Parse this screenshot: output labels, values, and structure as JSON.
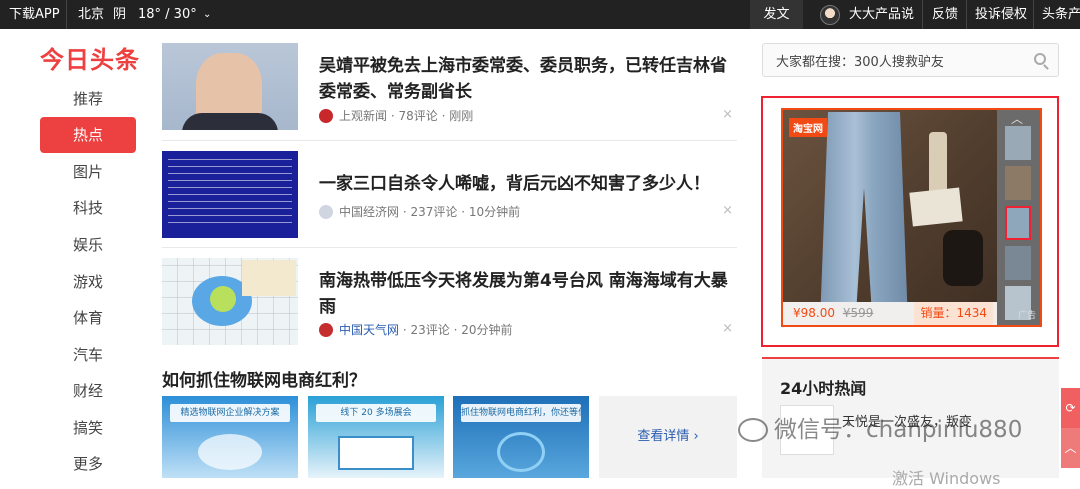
{
  "topbar": {
    "download": "下载APP",
    "city": "北京",
    "weather": "阴",
    "temp": "18° / 30°",
    "post": "发文",
    "user": "大大产品说",
    "feedback": "反馈",
    "complaint": "投诉侵权",
    "more": "头条产"
  },
  "logo": "今日头条",
  "nav": [
    "推荐",
    "热点",
    "图片",
    "科技",
    "娱乐",
    "游戏",
    "体育",
    "汽车",
    "财经",
    "搞笑",
    "更多"
  ],
  "articles": [
    {
      "title": "吴靖平被免去上海市委常委、委员职务，已转任吉林省委常委、常务副省长",
      "source": "上观新闻",
      "comments": "78评论",
      "time": "刚刚"
    },
    {
      "title": "一家三口自杀令人唏嘘，背后元凶不知害了多少人！",
      "source": "中国经济网",
      "comments": "237评论",
      "time": "10分钟前"
    },
    {
      "title": "南海热带低压今天将发展为第4号台风 南海海域有大暴雨",
      "source": "中国天气网",
      "comments": "23评论",
      "time": "20分钟前"
    }
  ],
  "section": {
    "title": "如何抓住物联网电商红利？",
    "promos": [
      "精选物联网企业解决方案",
      "线下 20 多场展会",
      "抓住物联网电商红利，你还等什么？"
    ],
    "more": "查看详情 ›"
  },
  "search": {
    "value": "大家都在搜：300人搜救驴友"
  },
  "ad": {
    "brand": "淘宝网",
    "price": "¥98.00",
    "old_price": "¥599",
    "sales": "销量：1434",
    "tag": "广告"
  },
  "hot": {
    "title": "24小时热闻",
    "item": "天悦是一次盛友，叛变",
    "faded": "激活 Windows"
  },
  "watermark": "微信号：chanpinlu880",
  "close_glyph": "×",
  "sep_dot": "·",
  "colors": {
    "brand_red": "#ed4040",
    "topbar": "#222222",
    "ad_orange": "#f24a14"
  }
}
